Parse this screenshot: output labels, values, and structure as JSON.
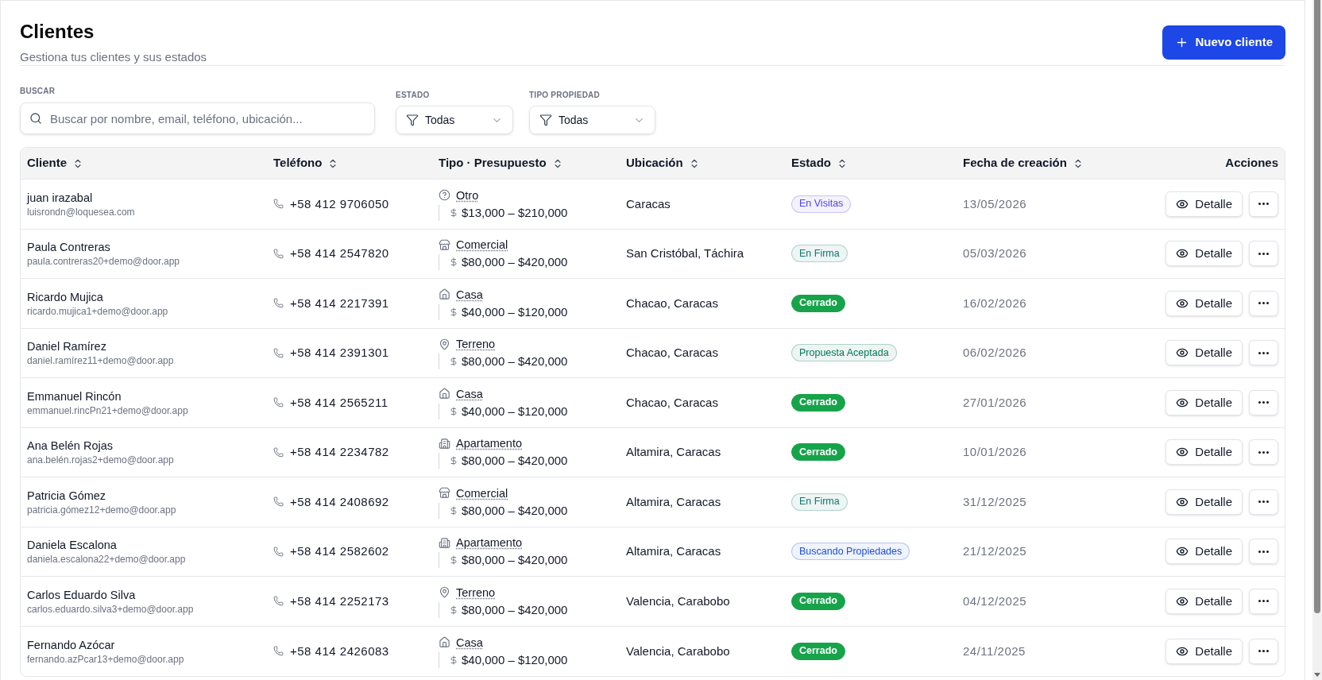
{
  "header": {
    "title": "Clientes",
    "subtitle": "Gestiona tus clientes y sus estados",
    "new_button": "Nuevo cliente"
  },
  "filters": {
    "search": {
      "label": "BUSCAR",
      "placeholder": "Buscar por nombre, email, teléfono, ubicación..."
    },
    "selects": [
      {
        "label": "ESTADO",
        "value": "Todas"
      },
      {
        "label": "TIPO PROPIEDAD",
        "value": "Todas"
      }
    ]
  },
  "table": {
    "columns": [
      {
        "label": "Cliente",
        "sortable": true
      },
      {
        "label": "Teléfono",
        "sortable": true
      },
      {
        "label": "Tipo · Presupuesto",
        "sortable": true
      },
      {
        "label": "Ubicación",
        "sortable": true
      },
      {
        "label": "Estado",
        "sortable": true
      },
      {
        "label": "Fecha de creación",
        "sortable": true
      },
      {
        "label": "Acciones",
        "sortable": false
      }
    ],
    "rows": [
      {
        "name": "juan irazabal",
        "email": "luisrondn@loquesea.com",
        "phone": "+58 412 9706050",
        "type": {
          "label": "Otro",
          "kind": "other"
        },
        "budget": "$13,000 – $210,000",
        "location": "Caracas",
        "status": {
          "label": "En Visitas",
          "kind": "soft",
          "color": "#4f46e5"
        },
        "created": "13/05/2026",
        "detail": "Detalle"
      },
      {
        "name": "Paula Contreras",
        "email": "paula.contreras20+demo@door.app",
        "phone": "+58 414 2547820",
        "type": {
          "label": "Comercial",
          "kind": "commercial"
        },
        "budget": "$80,000 – $420,000",
        "location": "San Cristóbal, Táchira",
        "status": {
          "label": "En Firma",
          "kind": "soft",
          "color": "#0f766e"
        },
        "created": "05/03/2026",
        "detail": "Detalle"
      },
      {
        "name": "Ricardo Mujica",
        "email": "ricardo.mujica1+demo@door.app",
        "phone": "+58 414 2217391",
        "type": {
          "label": "Casa",
          "kind": "house"
        },
        "budget": "$40,000 – $120,000",
        "location": "Chacao, Caracas",
        "status": {
          "label": "Cerrado",
          "kind": "solid",
          "color": "#16a34a"
        },
        "created": "16/02/2026",
        "detail": "Detalle"
      },
      {
        "name": "Daniel Ramírez",
        "email": "daniel.ramírez11+demo@door.app",
        "phone": "+58 414 2391301",
        "type": {
          "label": "Terreno",
          "kind": "land"
        },
        "budget": "$80,000 – $420,000",
        "location": "Chacao, Caracas",
        "status": {
          "label": "Propuesta Aceptada",
          "kind": "soft",
          "color": "#047857"
        },
        "created": "06/02/2026",
        "detail": "Detalle"
      },
      {
        "name": "Emmanuel Rincón",
        "email": "emmanuel.rincPn21+demo@door.app",
        "phone": "+58 414 2565211",
        "type": {
          "label": "Casa",
          "kind": "house"
        },
        "budget": "$40,000 – $120,000",
        "location": "Chacao, Caracas",
        "status": {
          "label": "Cerrado",
          "kind": "solid",
          "color": "#16a34a"
        },
        "created": "27/01/2026",
        "detail": "Detalle"
      },
      {
        "name": "Ana Belén Rojas",
        "email": "ana.belén.rojas2+demo@door.app",
        "phone": "+58 414 2234782",
        "type": {
          "label": "Apartamento",
          "kind": "apartment"
        },
        "budget": "$80,000 – $420,000",
        "location": "Altamira, Caracas",
        "status": {
          "label": "Cerrado",
          "kind": "solid",
          "color": "#16a34a"
        },
        "created": "10/01/2026",
        "detail": "Detalle"
      },
      {
        "name": "Patricia Gómez",
        "email": "patricia.gómez12+demo@door.app",
        "phone": "+58 414 2408692",
        "type": {
          "label": "Comercial",
          "kind": "commercial"
        },
        "budget": "$80,000 – $420,000",
        "location": "Altamira, Caracas",
        "status": {
          "label": "En Firma",
          "kind": "soft",
          "color": "#0f766e"
        },
        "created": "31/12/2025",
        "detail": "Detalle"
      },
      {
        "name": "Daniela Escalona",
        "email": "daniela.escalona22+demo@door.app",
        "phone": "+58 414 2582602",
        "type": {
          "label": "Apartamento",
          "kind": "apartment"
        },
        "budget": "$80,000 – $420,000",
        "location": "Altamira, Caracas",
        "status": {
          "label": "Buscando Propiedades",
          "kind": "soft",
          "color": "#1d4ed8"
        },
        "created": "21/12/2025",
        "detail": "Detalle"
      },
      {
        "name": "Carlos Eduardo Silva",
        "email": "carlos.eduardo.silva3+demo@door.app",
        "phone": "+58 414 2252173",
        "type": {
          "label": "Terreno",
          "kind": "land"
        },
        "budget": "$80,000 – $420,000",
        "location": "Valencia, Carabobo",
        "status": {
          "label": "Cerrado",
          "kind": "solid",
          "color": "#16a34a"
        },
        "created": "04/12/2025",
        "detail": "Detalle"
      },
      {
        "name": "Fernando Azócar",
        "email": "fernando.azPcar13+demo@door.app",
        "phone": "+58 414 2426083",
        "type": {
          "label": "Casa",
          "kind": "house"
        },
        "budget": "$40,000 – $120,000",
        "location": "Valencia, Carabobo",
        "status": {
          "label": "Cerrado",
          "kind": "solid",
          "color": "#16a34a"
        },
        "created": "24/11/2025",
        "detail": "Detalle"
      }
    ]
  }
}
